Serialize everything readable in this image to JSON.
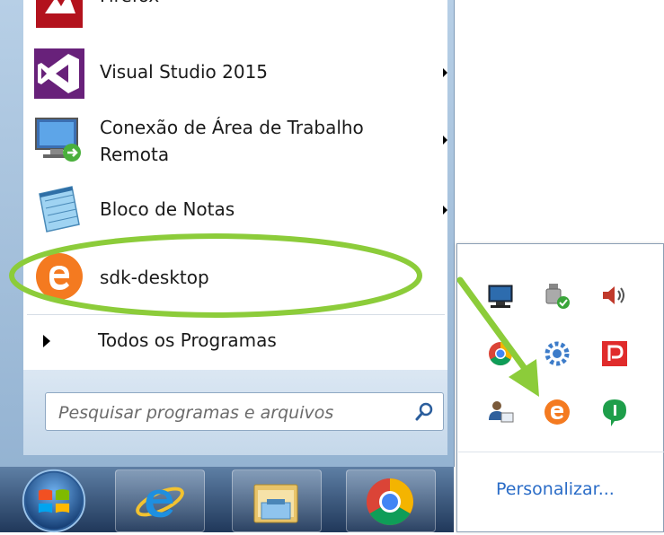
{
  "start_menu": {
    "items": [
      {
        "label": "Firefox",
        "icon": "firefox-app-icon",
        "has_submenu": true
      },
      {
        "label": "Visual Studio 2015",
        "icon": "visual-studio-icon",
        "has_submenu": true
      },
      {
        "label_line1": "Conexão de Área de Trabalho",
        "label_line2": "Remota",
        "icon": "remote-desktop-icon",
        "has_submenu": true
      },
      {
        "label": "Bloco de Notas",
        "icon": "notepad-icon",
        "has_submenu": true
      },
      {
        "label": "sdk-desktop",
        "icon": "sdk-desktop-icon",
        "has_submenu": false
      }
    ],
    "all_programs_label": "Todos os Programas",
    "search_placeholder": "Pesquisar programas e arquivos"
  },
  "taskbar": {
    "buttons": [
      "start-orb-icon",
      "internet-explorer-icon",
      "windows-explorer-icon",
      "chrome-icon"
    ]
  },
  "tray_popup": {
    "icons": [
      [
        "monitor-network-icon",
        "usb-device-icon",
        "speaker-icon"
      ],
      [
        "chrome-tray-icon",
        "gear-cloud-icon",
        "red-p-icon"
      ],
      [
        "user-card-icon",
        "sdk-tray-icon",
        "green-chat-icon"
      ]
    ],
    "customize_label": "Personalizar..."
  },
  "colors": {
    "highlight_annotation": "#8ccc3a",
    "sdk_orange": "#f47a20",
    "link_blue": "#2a6cc7"
  }
}
